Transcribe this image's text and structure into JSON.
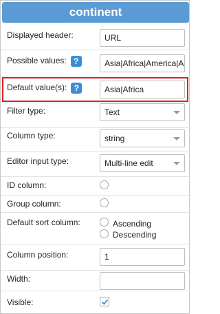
{
  "header": {
    "title": "continent"
  },
  "fields": {
    "displayed_header": {
      "label": "Displayed header:",
      "value": "URL"
    },
    "possible_values": {
      "label": "Possible values:",
      "value": "Asia|Africa|America|A"
    },
    "default_values": {
      "label": "Default value(s):",
      "value": "Asia|Africa"
    },
    "filter_type": {
      "label": "Filter type:",
      "value": "Text"
    },
    "column_type": {
      "label": "Column type:",
      "value": "string"
    },
    "editor_input_type": {
      "label": "Editor input type:",
      "value": "Multi-line edit"
    },
    "id_column": {
      "label": "ID column:"
    },
    "group_column": {
      "label": "Group column:"
    },
    "default_sort_column": {
      "label": "Default sort column:",
      "option_asc": "Ascending",
      "option_desc": "Descending"
    },
    "column_position": {
      "label": "Column position:",
      "value": "1"
    },
    "width": {
      "label": "Width:",
      "value": ""
    },
    "visible": {
      "label": "Visible:",
      "checked": true
    }
  },
  "help_icon": {
    "symbol": "?",
    "name": "question-mark-icon"
  },
  "colors": {
    "header_bg": "#5b9bd5",
    "help_icon_bg": "#3a8fd6",
    "highlight_border": "#e41e25",
    "checkmark": "#3a8fd6"
  }
}
